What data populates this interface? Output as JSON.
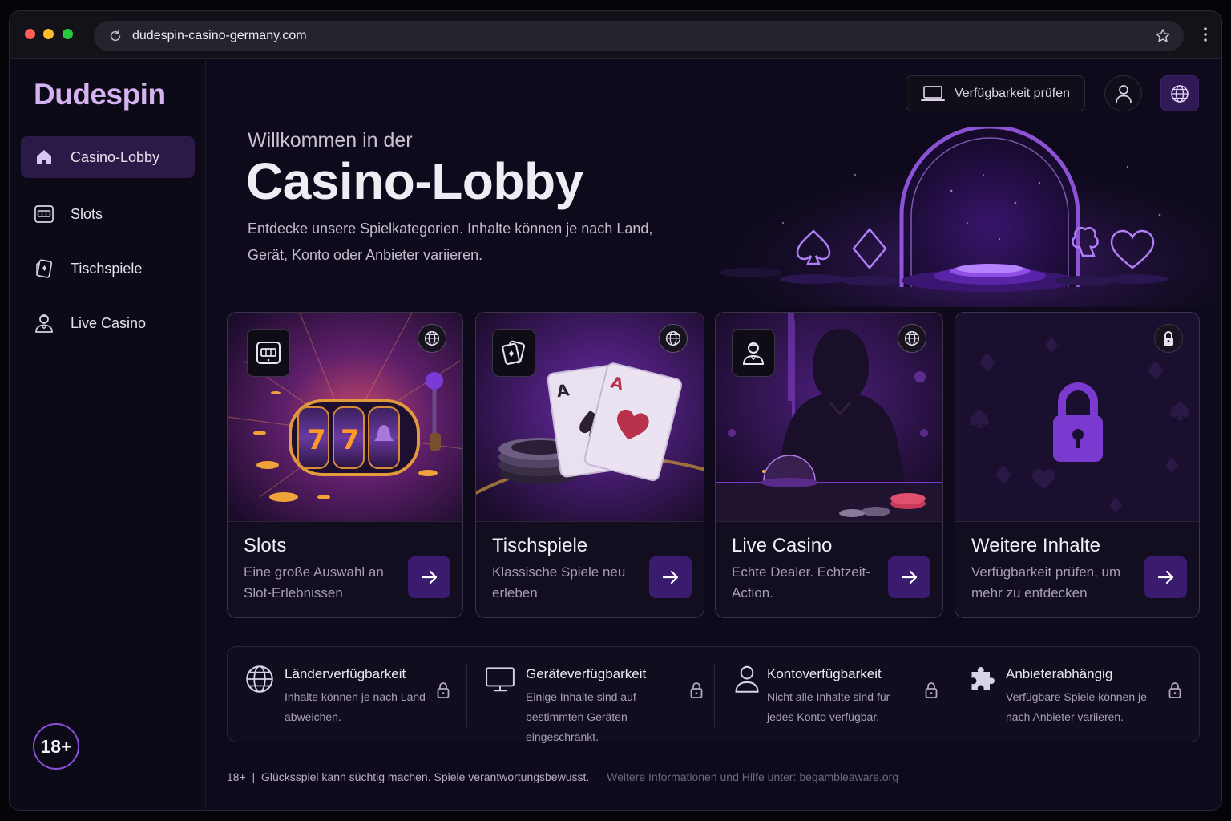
{
  "browser": {
    "url": "dudespin-casino-germany.com",
    "traffic_lights": [
      "#ff5f57",
      "#febc2e",
      "#28c840"
    ]
  },
  "sidebar": {
    "brand": "Dudespin",
    "items": [
      {
        "label": "Casino-Lobby",
        "icon": "home-icon",
        "active": true
      },
      {
        "label": "Slots",
        "icon": "slot-machine-icon",
        "active": false
      },
      {
        "label": "Tischspiele",
        "icon": "playing-card-icon",
        "active": false
      },
      {
        "label": "Live Casino",
        "icon": "dealer-icon",
        "active": false
      }
    ],
    "age_badge": "18+"
  },
  "header": {
    "availability_button": "Verfügbarkeit prüfen",
    "profile_icon": "user-icon",
    "language_icon": "globe-icon"
  },
  "hero": {
    "pre_title": "Willkommen in der",
    "title": "Casino-Lobby",
    "description": "Entdecke unsere Spielkategorien. Inhalte können je nach Land, Gerät, Konto oder Anbieter variieren."
  },
  "cards": [
    {
      "title": "Slots",
      "description": "Eine große Auswahl an Slot-Erlebnissen",
      "badge_icon": "slot-machine-icon",
      "corner_icon": "globe-icon"
    },
    {
      "title": "Tischspiele",
      "description": "Klassische Spiele neu erleben",
      "badge_icon": "playing-card-icon",
      "corner_icon": "globe-icon"
    },
    {
      "title": "Live Casino",
      "description": "Echte Dealer. Echtzeit-Action.",
      "badge_icon": "dealer-icon",
      "corner_icon": "globe-icon"
    },
    {
      "title": "Weitere Inhalte",
      "description": "Verfügbarkeit prüfen, um mehr zu entdecken",
      "badge_icon": "",
      "corner_icon": "lock-icon"
    }
  ],
  "availability_info": [
    {
      "title": "Länderverfügbarkeit",
      "description": "Inhalte können je nach Land abweichen.",
      "icon": "globe-icon"
    },
    {
      "title": "Geräteverfügbarkeit",
      "description": "Einige Inhalte sind auf bestimmten Geräten eingeschränkt.",
      "icon": "monitor-icon"
    },
    {
      "title": "Kontoverfügbarkeit",
      "description": "Nicht alle Inhalte sind für jedes Konto verfügbar.",
      "icon": "user-icon"
    },
    {
      "title": "Anbieterabhängig",
      "description": "Verfügbare Spiele können je nach Anbieter variieren.",
      "icon": "puzzle-icon"
    }
  ],
  "footer": {
    "notice": "18+  |  Glücksspiel kann süchtig machen. Spiele verantwortungsbewusst.",
    "help": "Weitere Informationen und Hilfe unter: begambleaware.org"
  },
  "colors": {
    "accent": "#8a4fd8",
    "brand": "#d5b3f2",
    "active_nav": "#2b1a47",
    "arrow_button": "#3a1b6d"
  }
}
